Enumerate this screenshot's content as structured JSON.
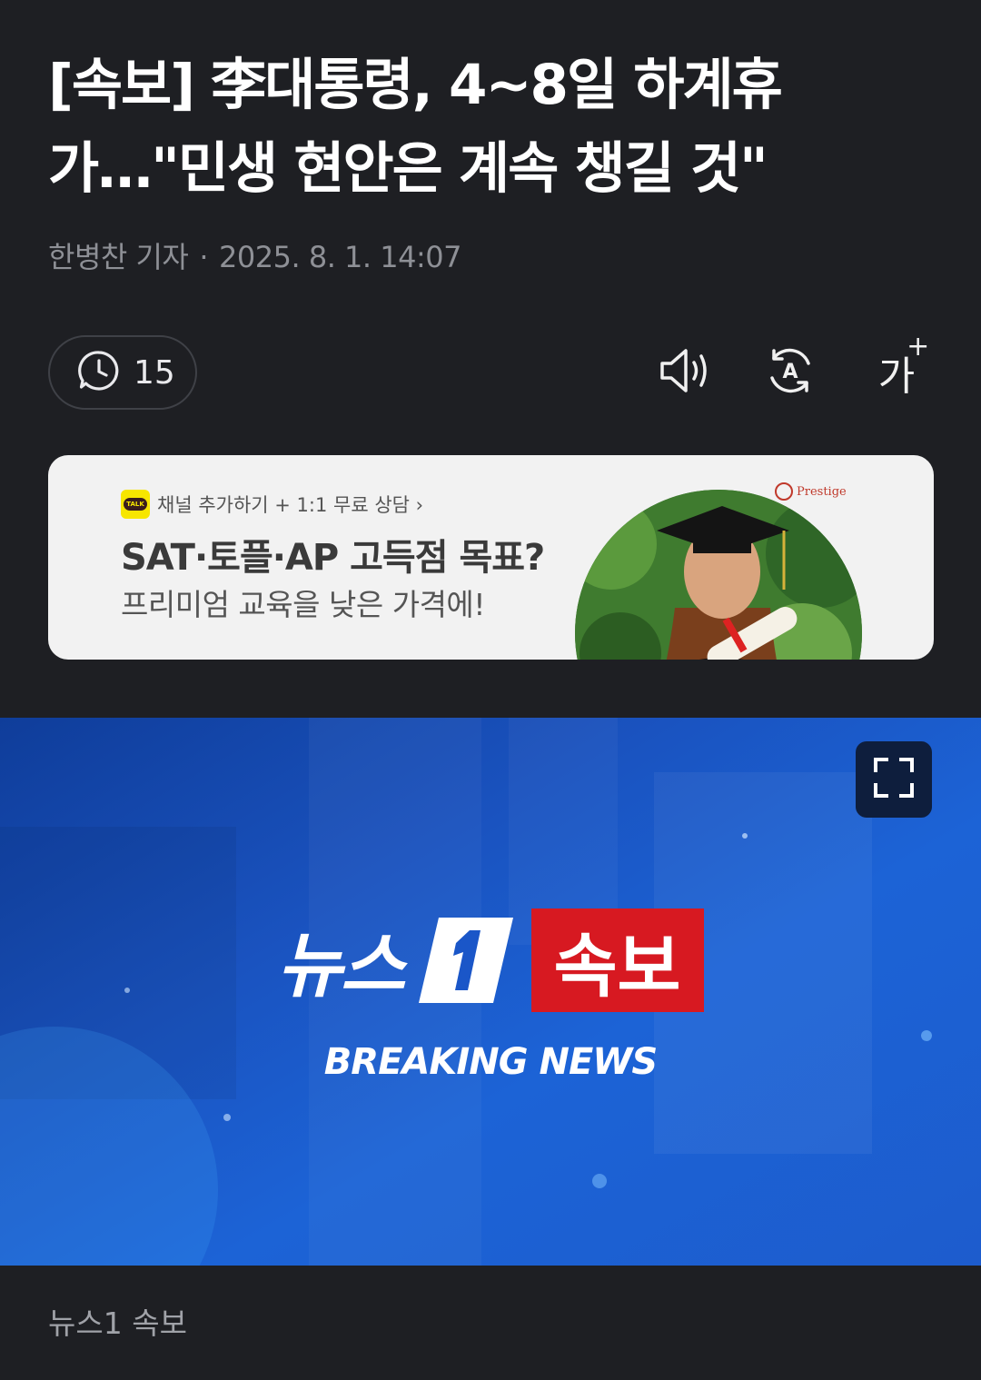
{
  "article": {
    "headline_line1": "[속보] 李대통령, 4~8일 하계휴",
    "headline_line2": "가…\"민생 현안은 계속 챙길 것\"",
    "author": "한병찬 기자",
    "separator": "·",
    "date": "2025. 8. 1. 14:07"
  },
  "toolbar": {
    "comment_count": "15",
    "icons": [
      "comment-clock-icon",
      "speaker-icon",
      "translate-icon",
      "font-size-icon"
    ],
    "font_size_label": "가",
    "font_size_plus": "+"
  },
  "ad": {
    "channel_text": "채널 추가하기 + 1:1 무료 상담 ›",
    "talk_badge": "TALK",
    "title": "SAT·토플·AP 고득점 목표?",
    "subtitle": "프리미엄 교육을 낮은 가격에!",
    "logo_text": "Prestige"
  },
  "image": {
    "brand_text": "뉴스",
    "badge_text": "속보",
    "breaking_text": "BREAKING NEWS",
    "caption": "뉴스1 속보"
  },
  "colors": {
    "background": "#1e1f23",
    "accent_red": "#d71921",
    "blue": "#1c63d6"
  }
}
